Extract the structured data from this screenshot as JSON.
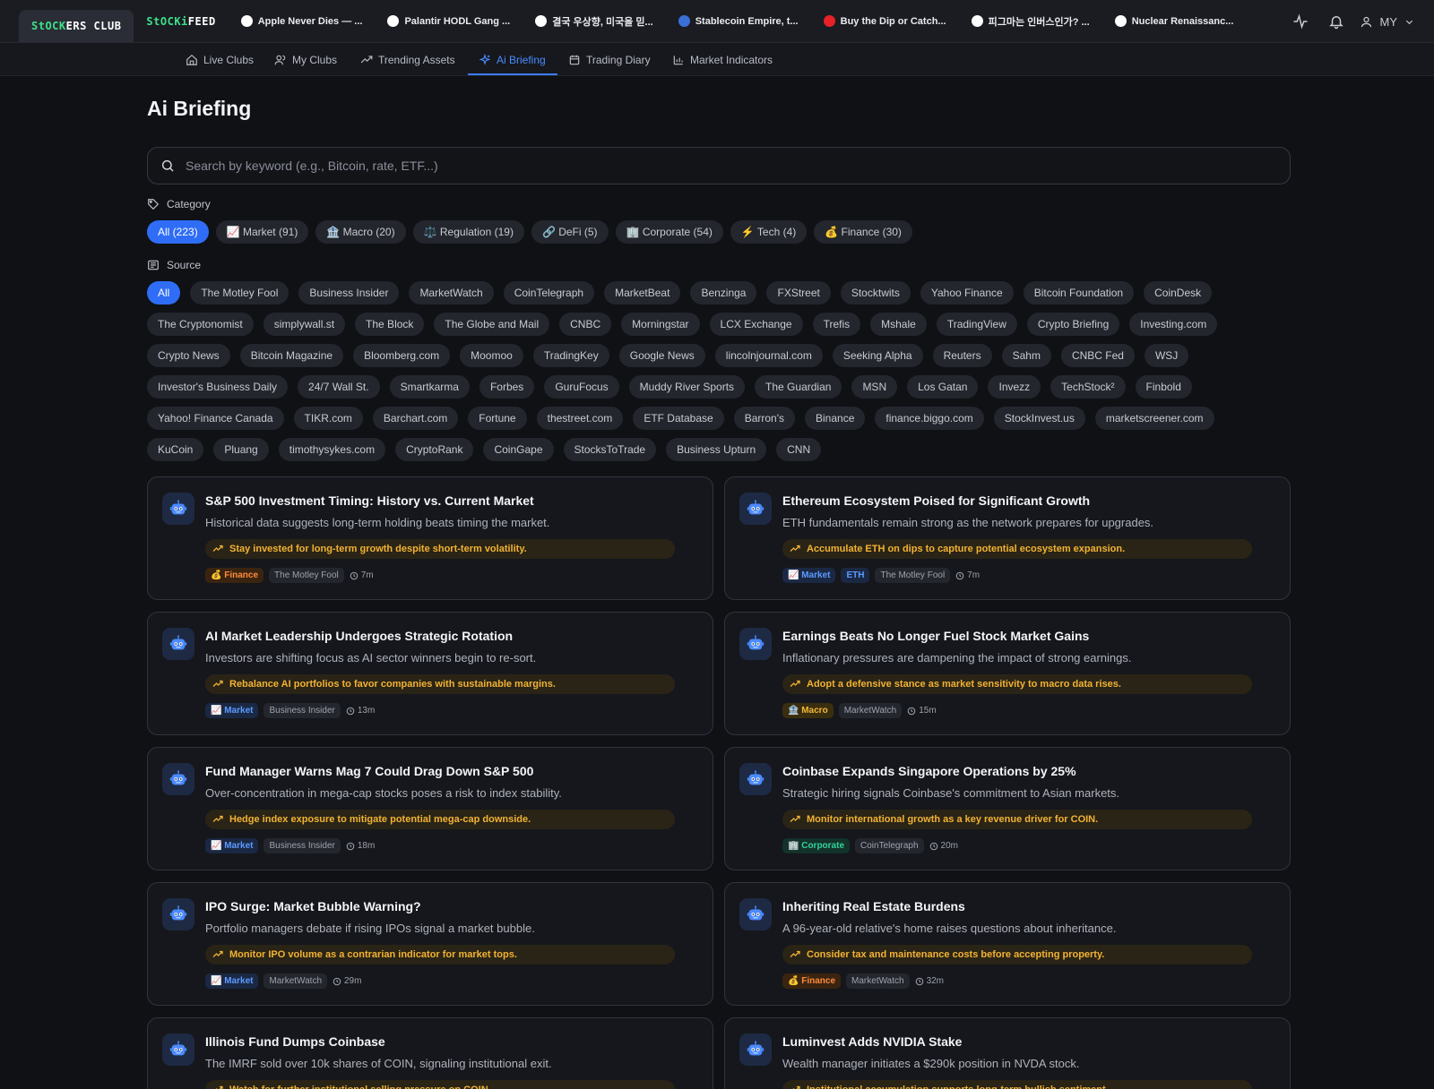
{
  "brand": {
    "club_a": "StOCK",
    "club_b": "ERS CLUB",
    "feed_a": "StOCKi",
    "feed_b": " FEED"
  },
  "club_tabs": [
    {
      "label": "Apple Never Dies — ...",
      "icon": "apple-icon",
      "color": "#ffffff"
    },
    {
      "label": "Palantir HODL Gang ...",
      "icon": "palantir-icon",
      "color": "#ffffff"
    },
    {
      "label": "결국 우상향, 미국을 믿...",
      "icon": "spy-icon",
      "color": "#ffffff"
    },
    {
      "label": "Stablecoin Empire, t...",
      "icon": "circle-icon",
      "color": "#3b6fd8"
    },
    {
      "label": "Buy the Dip or Catch...",
      "icon": "tesla-icon",
      "color": "#e82127"
    },
    {
      "label": "피그마는 인버스인가? ...",
      "icon": "figma-icon",
      "color": "#ffffff"
    },
    {
      "label": "Nuclear Renaissanc...",
      "icon": "nuclear-icon",
      "color": "#ffffff"
    }
  ],
  "user": {
    "label": "MY"
  },
  "nav": [
    {
      "label": "Live Clubs",
      "icon": "home-icon"
    },
    {
      "label": "My Clubs",
      "icon": "users-icon"
    },
    {
      "label": "Trending Assets",
      "icon": "trend-icon"
    },
    {
      "label": "Ai Briefing",
      "icon": "sparkle-icon",
      "active": true
    },
    {
      "label": "Trading Diary",
      "icon": "diary-icon"
    },
    {
      "label": "Market Indicators",
      "icon": "bars-icon"
    }
  ],
  "page": {
    "title": "Ai Briefing"
  },
  "search": {
    "placeholder": "Search by keyword (e.g., Bitcoin, rate, ETF...)"
  },
  "category": {
    "label": "Category",
    "chips": [
      "All (223)",
      "📈 Market (91)",
      "🏦 Macro (20)",
      "⚖️ Regulation (19)",
      "🔗 DeFi (5)",
      "🏢 Corporate (54)",
      "⚡ Tech (4)",
      "💰 Finance (30)"
    ]
  },
  "source": {
    "label": "Source",
    "chips": [
      "All",
      "The Motley Fool",
      "Business Insider",
      "MarketWatch",
      "CoinTelegraph",
      "MarketBeat",
      "Benzinga",
      "FXStreet",
      "Stocktwits",
      "Yahoo Finance",
      "Bitcoin Foundation",
      "CoinDesk",
      "The Cryptonomist",
      "simplywall.st",
      "The Block",
      "The Globe and Mail",
      "CNBC",
      "Morningstar",
      "LCX Exchange",
      "Trefis",
      "Mshale",
      "TradingView",
      "Crypto Briefing",
      "Investing.com",
      "Crypto News",
      "Bitcoin Magazine",
      "Bloomberg.com",
      "Moomoo",
      "TradingKey",
      "Google News",
      "lincolnjournal.com",
      "Seeking Alpha",
      "Reuters",
      "Sahm",
      "CNBC Fed",
      "WSJ",
      "Investor's Business Daily",
      "24/7 Wall St.",
      "Smartkarma",
      "Forbes",
      "GuruFocus",
      "Muddy River Sports",
      "The Guardian",
      "MSN",
      "Los Gatan",
      "Invezz",
      "TechStock²",
      "Finbold",
      "Yahoo! Finance Canada",
      "TIKR.com",
      "Barchart.com",
      "Fortune",
      "thestreet.com",
      "ETF Database",
      "Barron's",
      "Binance",
      "finance.biggo.com",
      "StockInvest.us",
      "marketscreener.com",
      "KuCoin",
      "Pluang",
      "timothysykes.com",
      "CryptoRank",
      "CoinGape",
      "StocksToTrade",
      "Business Upturn",
      "CNN"
    ]
  },
  "cards": [
    {
      "title": "S&P 500 Investment Timing: History vs. Current Market",
      "summary": "Historical data suggests long-term holding beats timing the market.",
      "tip": "Stay invested for long-term growth despite short-term volatility.",
      "tags": [
        {
          "label": "💰 Finance",
          "kind": "finance"
        }
      ],
      "source": "The Motley Fool",
      "time": "7m"
    },
    {
      "title": "Ethereum Ecosystem Poised for Significant Growth",
      "summary": "ETH fundamentals remain strong as the network prepares for upgrades.",
      "tip": "Accumulate ETH on dips to capture potential ecosystem expansion.",
      "tags": [
        {
          "label": "📈 Market",
          "kind": "market"
        },
        {
          "label": "ETH",
          "kind": "ticker"
        }
      ],
      "source": "The Motley Fool",
      "time": "7m"
    },
    {
      "title": "AI Market Leadership Undergoes Strategic Rotation",
      "summary": "Investors are shifting focus as AI sector winners begin to re-sort.",
      "tip": "Rebalance AI portfolios to favor companies with sustainable margins.",
      "tags": [
        {
          "label": "📈 Market",
          "kind": "market"
        }
      ],
      "source": "Business Insider",
      "time": "13m"
    },
    {
      "title": "Earnings Beats No Longer Fuel Stock Market Gains",
      "summary": "Inflationary pressures are dampening the impact of strong earnings.",
      "tip": "Adopt a defensive stance as market sensitivity to macro data rises.",
      "tags": [
        {
          "label": "🏦 Macro",
          "kind": "macro"
        }
      ],
      "source": "MarketWatch",
      "time": "15m"
    },
    {
      "title": "Fund Manager Warns Mag 7 Could Drag Down S&P 500",
      "summary": "Over-concentration in mega-cap stocks poses a risk to index stability.",
      "tip": "Hedge index exposure to mitigate potential mega-cap downside.",
      "tags": [
        {
          "label": "📈 Market",
          "kind": "market"
        }
      ],
      "source": "Business Insider",
      "time": "18m"
    },
    {
      "title": "Coinbase Expands Singapore Operations by 25%",
      "summary": "Strategic hiring signals Coinbase's commitment to Asian markets.",
      "tip": "Monitor international growth as a key revenue driver for COIN.",
      "tags": [
        {
          "label": "🏢 Corporate",
          "kind": "corporate"
        }
      ],
      "source": "CoinTelegraph",
      "time": "20m"
    },
    {
      "title": "IPO Surge: Market Bubble Warning?",
      "summary": "Portfolio managers debate if rising IPOs signal a market bubble.",
      "tip": "Monitor IPO volume as a contrarian indicator for market tops.",
      "tags": [
        {
          "label": "📈 Market",
          "kind": "market"
        }
      ],
      "source": "MarketWatch",
      "time": "29m"
    },
    {
      "title": "Inheriting Real Estate Burdens",
      "summary": "A 96-year-old relative's home raises questions about inheritance.",
      "tip": "Consider tax and maintenance costs before accepting property.",
      "tags": [
        {
          "label": "💰 Finance",
          "kind": "finance"
        }
      ],
      "source": "MarketWatch",
      "time": "32m"
    },
    {
      "title": "Illinois Fund Dumps Coinbase",
      "summary": "The IMRF sold over 10k shares of COIN, signaling institutional exit.",
      "tip": "Watch for further institutional selling pressure on COIN.",
      "tags": [],
      "source": "",
      "time": ""
    },
    {
      "title": "Luminvest Adds NVIDIA Stake",
      "summary": "Wealth manager initiates a $290k position in NVDA stock.",
      "tip": "Institutional accumulation supports long-term bullish sentiment.",
      "tags": [],
      "source": "",
      "time": ""
    }
  ]
}
